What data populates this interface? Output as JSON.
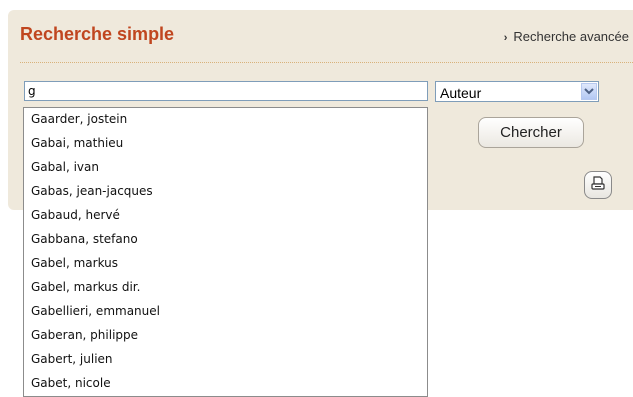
{
  "header": {
    "title": "Recherche simple",
    "advanced_link": "Recherche avancée"
  },
  "search": {
    "value": "g",
    "field_select": "Auteur",
    "submit_label": "Chercher"
  },
  "suggestions": [
    "Gaarder, jostein",
    "Gabai, mathieu",
    "Gabal, ivan",
    "Gabas, jean-jacques",
    "Gabaud, hervé",
    "Gabbana, stefano",
    "Gabel, markus",
    "Gabel, markus dir.",
    "Gabellieri, emmanuel",
    "Gaberan, philippe",
    "Gabert, julien",
    "Gabet, nicole"
  ],
  "icons": {
    "advanced_link_icon": "chevron-right-icon",
    "select_icon": "chevron-down-icon",
    "print_icon": "printer-icon"
  },
  "colors": {
    "panel_bg": "#efe9dc",
    "title": "#c0461f",
    "divider": "#d9b27a"
  }
}
